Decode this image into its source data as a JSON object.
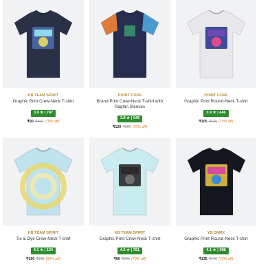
{
  "products": [
    {
      "brand": "KB TEAM SPIRIT",
      "name": "Graphic Print Crew-Neck T-shirt",
      "rating": "3.9 ★ | 747",
      "price": "₹90",
      "mrp": "₹299",
      "discount": "(70% off)",
      "shirt_color": "#2a3146",
      "print_colors": [
        "#8fd8e8",
        "#d8d060",
        "#4a6aa8"
      ],
      "icon": "tshirt-icon"
    },
    {
      "brand": "POINT COVE",
      "name": "Brand Print Crew-Neck T-shirt with Raglan Sleeves",
      "rating": "3.8 ★ | 548",
      "price": "₹120",
      "mrp": "₹399",
      "discount": "(70% off)",
      "shirt_color": "#262d4e",
      "print_colors": [
        "#e07a3a",
        "#4a9ad0",
        "#3aa070"
      ],
      "icon": "tshirt-icon"
    },
    {
      "brand": "POINT COVE",
      "name": "Graphic Print Round-Neck T-shirt",
      "rating": "3.9 ★ | 446",
      "price": "₹105",
      "mrp": "₹349",
      "discount": "(70% off)",
      "shirt_color": "#e8e8ec",
      "print_colors": [
        "#6a4ab0",
        "#e04a8a",
        "#2a3a90"
      ],
      "icon": "tshirt-icon"
    },
    {
      "brand": "KB TEAM SPIRIT",
      "name": "Tie & Dye Crew-Neck T-shirt",
      "rating": "4.1 ★ | 124",
      "price": "₹160",
      "mrp": "₹399",
      "discount": "(60% off)",
      "shirt_color": "#bfe3ee",
      "print_colors": [
        "#e8d870",
        "#8ccde0",
        "#f0e8b0"
      ],
      "icon": "tshirt-icon"
    },
    {
      "brand": "KB TEAM SPIRIT",
      "name": "Graphic Print Crew-Neck T-shirt",
      "rating": "4.2 ★ | 351",
      "price": "₹90",
      "mrp": "₹299",
      "discount": "(70% off)",
      "shirt_color": "#c8ecef",
      "print_colors": [
        "#2a2a2a",
        "#707070",
        "#2a2a2a"
      ],
      "icon": "tshirt-icon"
    },
    {
      "brand": "YB DNMX",
      "name": "Graphic Print Round-Neck T-shirt",
      "rating": "4.1 ★ | 388",
      "price": "₹135",
      "mrp": "₹449",
      "discount": "(70% off)",
      "shirt_color": "#15171f",
      "print_colors": [
        "#d84a9a",
        "#3a8ad8",
        "#e0c040"
      ],
      "icon": "tshirt-icon"
    }
  ]
}
